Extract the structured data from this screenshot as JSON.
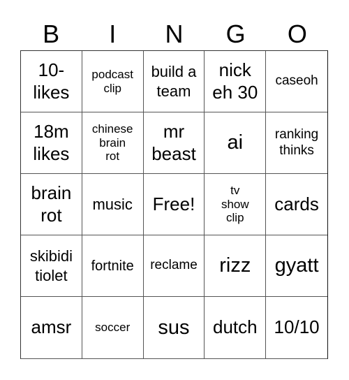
{
  "header": {
    "letters": [
      "B",
      "I",
      "N",
      "G",
      "O"
    ]
  },
  "grid": {
    "rows": [
      [
        "10-\nlikes",
        "podcast\nclip",
        "build a\nteam",
        "nick\neh 30",
        "caseoh"
      ],
      [
        "18m\nlikes",
        "chinese\nbrain\nrot",
        "mr\nbeast",
        "ai",
        "ranking\nthinks"
      ],
      [
        "brain\nrot",
        "music",
        "Free!",
        "tv\nshow\nclip",
        "cards"
      ],
      [
        "skibidi\ntiolet",
        "fortnite",
        "reclame",
        "rizz",
        "gyatt"
      ],
      [
        "amsr",
        "soccer",
        "sus",
        "dutch",
        "10/10"
      ]
    ]
  }
}
